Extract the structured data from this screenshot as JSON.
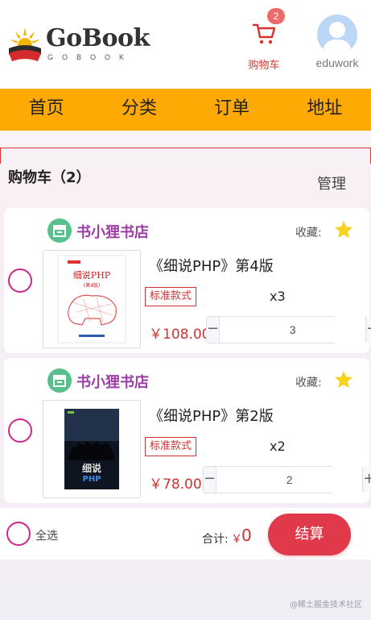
{
  "header": {
    "logo_text": "GoBook",
    "logo_sub": "GOBOOK",
    "cart_badge": "2",
    "cart_label": "购物车",
    "user_label": "eduwork"
  },
  "nav": {
    "items": [
      {
        "label": "首页"
      },
      {
        "label": "分类"
      },
      {
        "label": "订单"
      },
      {
        "label": "地址"
      }
    ]
  },
  "page": {
    "title": "购物车（2）",
    "manage_label": "管理"
  },
  "cart_items": [
    {
      "shop_name": "书小狸书店",
      "favorite_label": "收藏:",
      "title": "《细说PHP》第4版",
      "spec": "标准款式",
      "count_label": "x3",
      "price": "￥108.00",
      "quantity": "3",
      "cover_text": "细说PHP",
      "cover_edition": "(第4版)"
    },
    {
      "shop_name": "书小狸书店",
      "favorite_label": "收藏:",
      "title": "《细说PHP》第2版",
      "spec": "标准款式",
      "count_label": "x2",
      "price": "￥78.00",
      "quantity": "2",
      "cover_text": "细说",
      "cover_sub": "PHP"
    }
  ],
  "footer": {
    "select_all_label": "全选",
    "total_label": "合计:",
    "currency_symbol": "￥",
    "total_value": "0",
    "checkout_label": "结算"
  },
  "watermark": "@稀土掘金技术社区",
  "colors": {
    "nav_bg": "#fea904",
    "accent_red": "#e03a4a",
    "shop_name": "#9b3ea3",
    "select_ring": "#d0258c",
    "shop_icon": "#57c08d",
    "star": "#f7d21e"
  }
}
